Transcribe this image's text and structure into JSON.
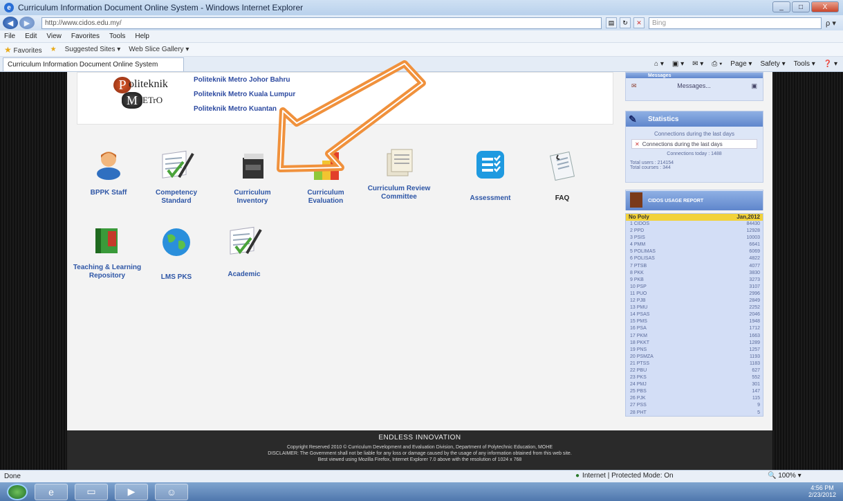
{
  "window": {
    "title": "Curriculum Information Document Online System - Windows Internet Explorer",
    "minimize": "_",
    "maximize": "□",
    "close": "X"
  },
  "address_bar": {
    "url": "http://www.cidos.edu.my/",
    "search_placeholder": "Bing",
    "search_go": "ρ ▾"
  },
  "menu": [
    "File",
    "Edit",
    "View",
    "Favorites",
    "Tools",
    "Help"
  ],
  "favorites_bar": {
    "favorites": "Favorites",
    "suggested": "Suggested Sites ▾",
    "web_slice": "Web Slice Gallery ▾"
  },
  "tab": {
    "label": "Curriculum Information Document Online System"
  },
  "command_bar": [
    "Page ▾",
    "Safety ▾",
    "Tools ▾"
  ],
  "logo": {
    "line1_p": "P",
    "line1": "oliteknik",
    "line2_m": "M",
    "line2": "ETrO"
  },
  "poly_links": [
    "Politeknik Metro Johor Bahru",
    "Politeknik Metro Kuala Lumpur",
    "Politeknik Metro Kuantan"
  ],
  "icons": [
    {
      "name": "bppk-staff",
      "label": "BPPK Staff",
      "icon": "staff-person-icon"
    },
    {
      "name": "competency-standard",
      "label": "Competency Standard",
      "icon": "checklist-pen-icon"
    },
    {
      "name": "curriculum-inventory",
      "label": "Curriculum Inventory",
      "icon": "filing-cabinet-icon"
    },
    {
      "name": "curriculum-evaluation",
      "label": "Curriculum Evaluation",
      "icon": "bar-chart-icon"
    },
    {
      "name": "curriculum-review-committee",
      "label": "Curriculum Review Committee",
      "icon": "documents-icon"
    },
    {
      "name": "assessment",
      "label": "Assessment",
      "icon": "checklist-icon"
    },
    {
      "name": "faq",
      "label": "FAQ",
      "icon": "faq-document-icon"
    },
    {
      "name": "teaching-learning-repository",
      "label": "Teaching & Learning Repository",
      "icon": "book-icon"
    },
    {
      "name": "lms-pks",
      "label": "LMS PKS",
      "icon": "globe-icon"
    },
    {
      "name": "academic",
      "label": "Academic",
      "icon": "checklist-pen-icon"
    }
  ],
  "sidebar": {
    "messages_title": "Messages",
    "messages_link": "Messages...",
    "statistics_title": "Statistics",
    "stats_caption": "Connections during the last days",
    "stats_img_alt": "Connections during the last days",
    "connections_today": "Connections today : 1488",
    "total_users": "Total users : 214154",
    "total_courses": "Total courses : 344",
    "usage_title": "CIDOS USAGE REPORT",
    "usage_header_left": "No Poly",
    "usage_header_right": "Jan,2012",
    "usage_rows": [
      [
        "1 CIDOS",
        "84430"
      ],
      [
        "2 PPD",
        "12928"
      ],
      [
        "3 PSIS",
        "10003"
      ],
      [
        "4 PMM",
        "6641"
      ],
      [
        "5 POLIMAS",
        "6069"
      ],
      [
        "6 POLISAS",
        "4822"
      ],
      [
        "7 PTSB",
        "4077"
      ],
      [
        "8 PKK",
        "3830"
      ],
      [
        "9 PKB",
        "3273"
      ],
      [
        "10 PSP",
        "3107"
      ],
      [
        "11 PUO",
        "2996"
      ],
      [
        "12 PJB",
        "2849"
      ],
      [
        "13 PMU",
        "2252"
      ],
      [
        "14 PSAS",
        "2046"
      ],
      [
        "15 PMS",
        "1948"
      ],
      [
        "16 PSA",
        "1712"
      ],
      [
        "17 PKM",
        "1663"
      ],
      [
        "18 PKKT",
        "1289"
      ],
      [
        "19 PNS",
        "1257"
      ],
      [
        "20 PSMZA",
        "1193"
      ],
      [
        "21 PTSS",
        "1183"
      ],
      [
        "22 PBU",
        "627"
      ],
      [
        "23 PKS",
        "552"
      ],
      [
        "24 PMJ",
        "301"
      ],
      [
        "25 PBS",
        "147"
      ],
      [
        "26 PJK",
        "115"
      ],
      [
        "27 PSS",
        "9"
      ],
      [
        "28 PHT",
        "5"
      ]
    ]
  },
  "footer": {
    "heading": "ENDLESS INNOVATION",
    "line1": "Copyright Reserved 2010 © Curriculum Development and Evaluation Division, Department of Polytechnic Education, MOHE",
    "line2": "DISCLAIMER: The Government shall not be liable for any loss or damage caused by the usage of any information obtained from this web site.",
    "line3": "Best viewed using Mozilla Firefox, Internet Explorer 7.0 above with the resolution of 1024 x 768"
  },
  "status_bar": {
    "left": "Done",
    "zone": "Internet | Protected Mode: On",
    "zoom": "100% ▾"
  },
  "taskbar": {
    "time": "4:56 PM",
    "date": "2/23/2012"
  },
  "colors": {
    "link_blue": "#2e56a6",
    "arrow_orange": "#f0913c",
    "sidebar_bg": "#dde6f7",
    "footer_bg": "#2a2a2a"
  }
}
